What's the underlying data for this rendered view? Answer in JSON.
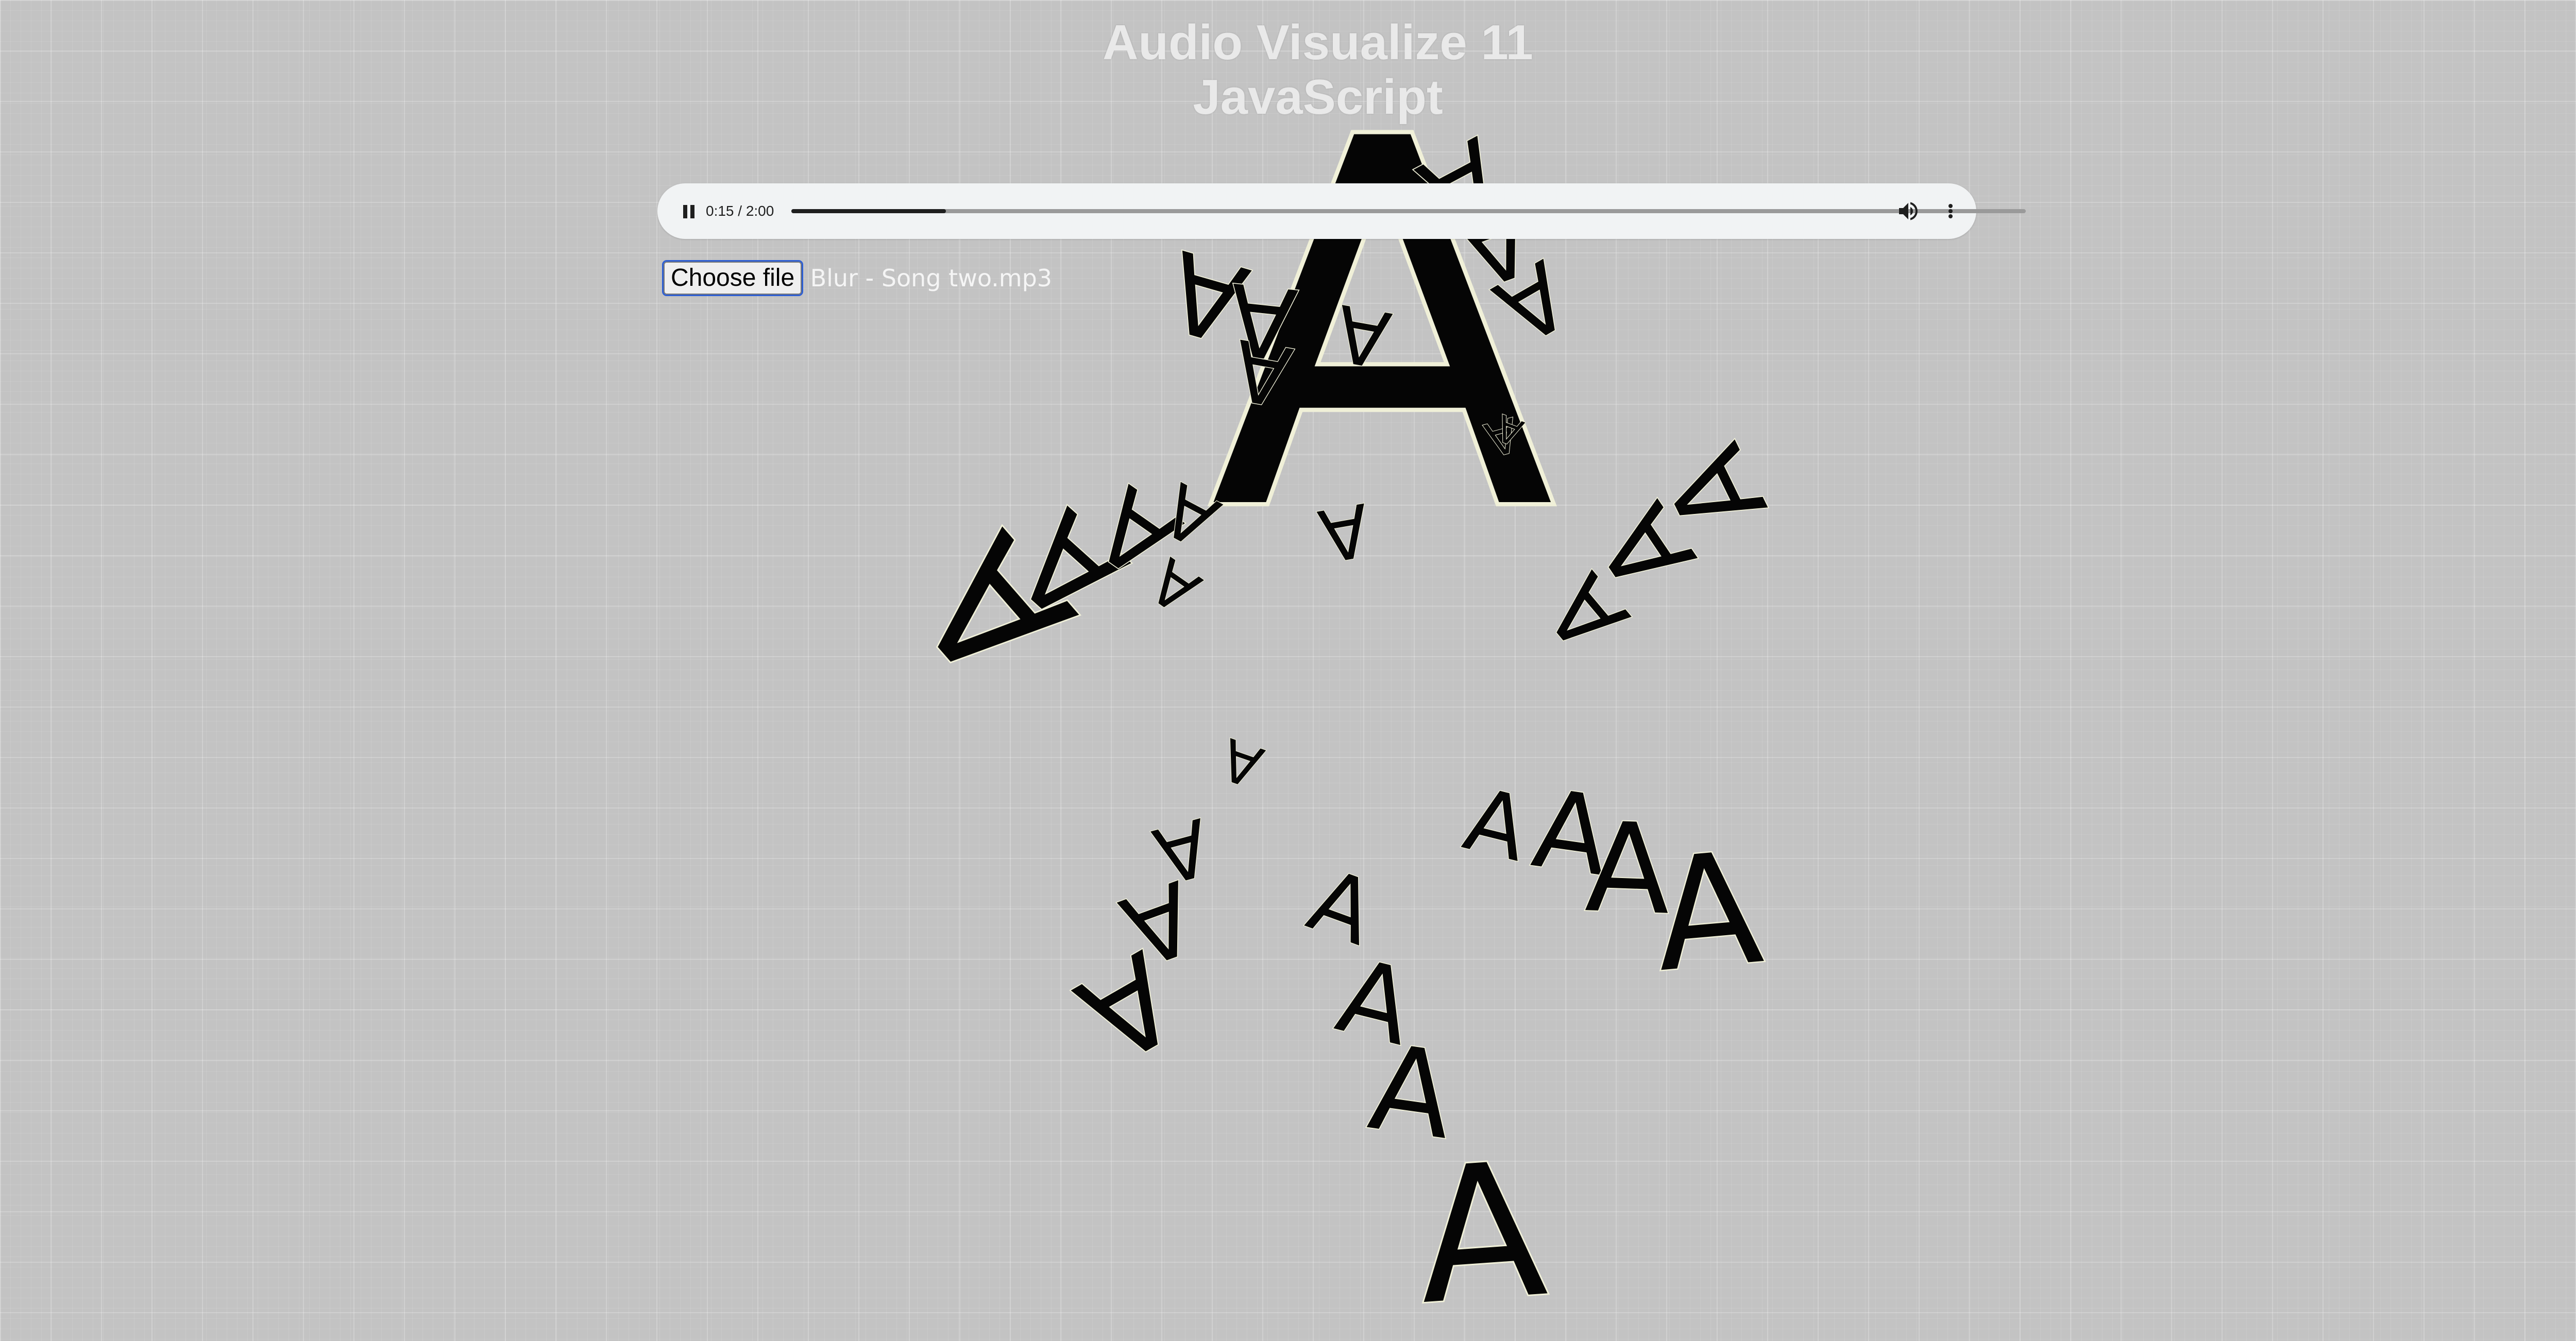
{
  "page": {
    "title_line1": "Audio Visualize 11",
    "title_line2": "JavaScript"
  },
  "player": {
    "time_display": "0:15 / 2:00",
    "progress_fraction": 0.125,
    "pause_icon": "pause-icon",
    "volume_icon": "volume-icon",
    "more_icon": "more-vert-icon"
  },
  "file_input": {
    "button_label": "Choose file",
    "file_name": "Blur - Song two.mp3"
  },
  "visualizer": {
    "glyph": "A",
    "glyph_count": 31,
    "glyph_fill": "#050505",
    "glyph_outline": "#f0f0d8"
  }
}
